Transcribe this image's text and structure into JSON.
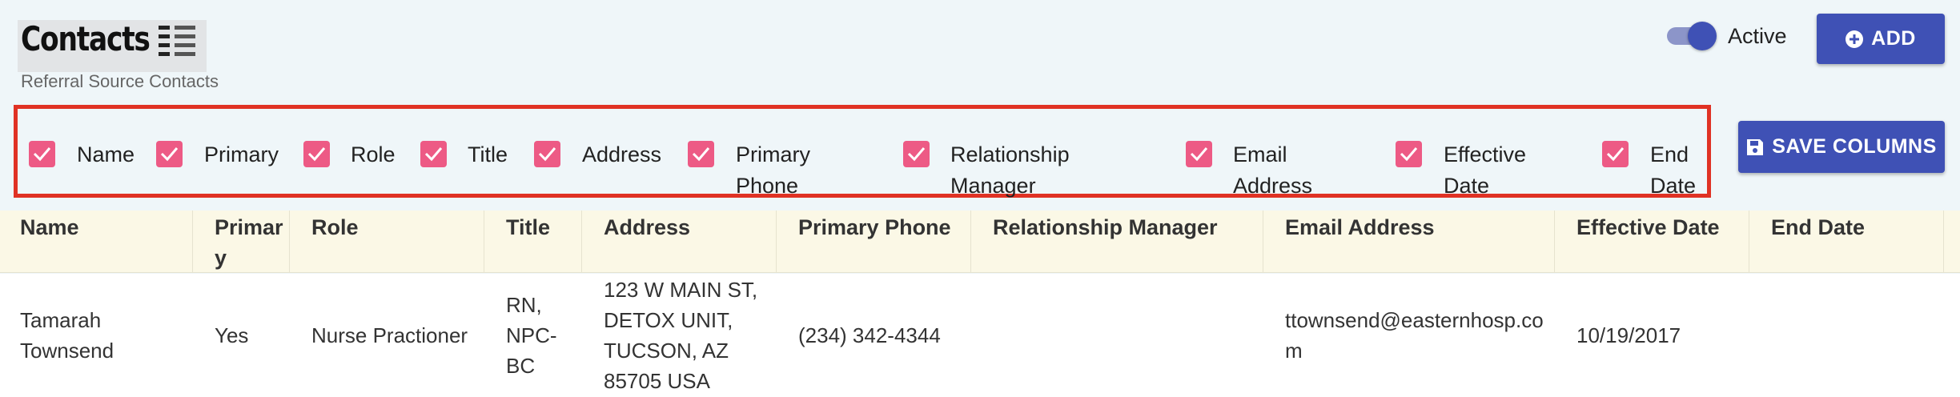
{
  "header": {
    "title": "Contacts",
    "subtitle": "Referral Source Contacts",
    "view_icon": "list-view-icon"
  },
  "toolbar": {
    "active_label": "Active",
    "active_on": true,
    "add_label": "ADD",
    "add_icon": "plus-circle-icon",
    "save_columns_label": "SAVE COLUMNS",
    "save_icon": "floppy-disk-icon"
  },
  "column_selector": {
    "items": [
      {
        "label": "Name",
        "checked": true
      },
      {
        "label": "Primary",
        "checked": true
      },
      {
        "label": "Role",
        "checked": true
      },
      {
        "label": "Title",
        "checked": true
      },
      {
        "label": "Address",
        "checked": true
      },
      {
        "label": "Primary Phone",
        "checked": true
      },
      {
        "label": "Relationship Manager",
        "checked": true
      },
      {
        "label": "Email Address",
        "checked": true
      },
      {
        "label": "Effective Date",
        "checked": true
      },
      {
        "label": "End Date",
        "checked": true
      }
    ]
  },
  "table": {
    "headers": [
      "Name",
      "Primary",
      "Role",
      "Title",
      "Address",
      "Primary Phone",
      "Relationship Manager",
      "Email Address",
      "Effective Date",
      "End Date"
    ],
    "rows": [
      {
        "name": "Tamarah Townsend",
        "primary": "Yes",
        "role": "Nurse Practioner",
        "title": "RN, NPC-BC",
        "address": "123 W MAIN ST, DETOX UNIT, TUCSON, AZ 85705 USA",
        "primary_phone": "(234) 342-4344",
        "relationship_manager": "",
        "email": "ttownsend@easternhosp.com",
        "effective_date": "10/19/2017",
        "end_date": ""
      }
    ]
  },
  "colors": {
    "accent": "#3f51b5",
    "checkbox": "#ed5a85",
    "highlight_border": "#e03224",
    "header_row_bg": "#fbf8e6",
    "page_bg": "#eff6f9"
  }
}
